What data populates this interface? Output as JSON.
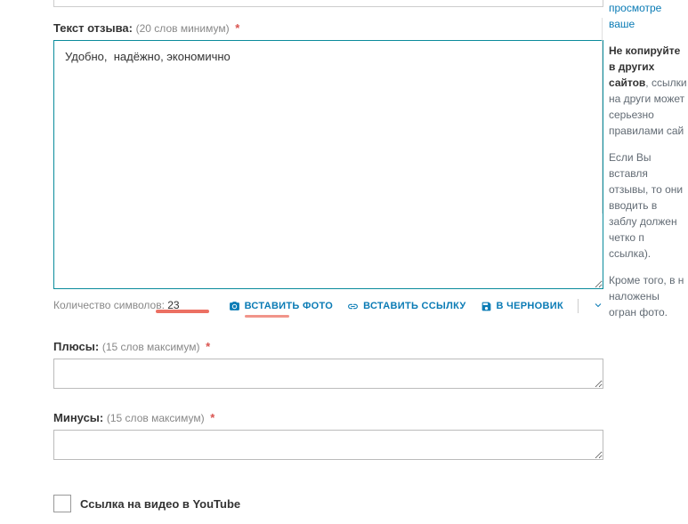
{
  "review": {
    "label": "Текст отзыва:",
    "hint": "(20 слов минимум)",
    "value": "Удобно,  надёжно, экономично"
  },
  "char_counter": {
    "label": "Количество символов:",
    "value": "23"
  },
  "actions": {
    "insert_photo": "ВСТАВИТЬ ФОТО",
    "insert_link": "ВСТАВИТЬ ССЫЛКУ",
    "draft": "В ЧЕРНОВИК"
  },
  "pluses": {
    "label": "Плюсы:",
    "hint": "(15 слов максимум)",
    "value": ""
  },
  "minuses": {
    "label": "Минусы:",
    "hint": "(15 слов максимум)",
    "value": ""
  },
  "youtube": {
    "label": "Ссылка на видео в YouTube",
    "checked": false
  },
  "sidebar": {
    "line0": "просмотре ваше",
    "para1_bold": "Не копируйте в",
    "para1_bold2": "других сайтов",
    "para1_rest": ", ссылки на други может серьезно правилами сай",
    "para2": "Если Вы вставля отзывы, то они вводить в заблу должен четко п ссылка).",
    "para3": "Кроме того, в н наложены огран фото."
  }
}
